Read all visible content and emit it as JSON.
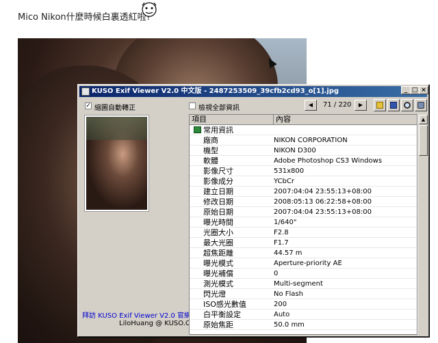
{
  "post": {
    "title": "Mico Nikon什麼時候白裏透紅啦?"
  },
  "window": {
    "title": "KUSO Exif Viewer V2.0 中文版 - 2487253509_39cfb2cd93_o[1].jpg",
    "controls": {
      "minimize": "_",
      "maximize": "□",
      "close": "×"
    }
  },
  "options": {
    "auto_rotate_label": "縮圖自動轉正",
    "auto_rotate_checked": "✓",
    "show_all_label": "檢視全部資訊"
  },
  "navigation": {
    "prev": "◀",
    "next": "▶",
    "counter": "71 / 220"
  },
  "grid": {
    "headers": {
      "item": "項目",
      "content": "內容"
    },
    "group": "常用資訊",
    "rows": [
      {
        "k": "廠商",
        "v": "NIKON CORPORATION"
      },
      {
        "k": "機型",
        "v": "NIKON D300"
      },
      {
        "k": "軟體",
        "v": "Adobe Photoshop CS3 Windows"
      },
      {
        "k": "影像尺寸",
        "v": "531x800"
      },
      {
        "k": "影像成分",
        "v": "YCbCr"
      },
      {
        "k": "建立日期",
        "v": "2007:04:04 23:55:13+08:00"
      },
      {
        "k": "修改日期",
        "v": "2008:05:13 06:22:58+08:00"
      },
      {
        "k": "原始日期",
        "v": "2007:04:04 23:55:13+08:00"
      },
      {
        "k": "曝光時間",
        "v": "1/640\""
      },
      {
        "k": "光圈大小",
        "v": "F2.8"
      },
      {
        "k": "最大光圈",
        "v": "F1.7"
      },
      {
        "k": "超焦距離",
        "v": "44.57 m"
      },
      {
        "k": "曝光模式",
        "v": "Aperture-priority AE"
      },
      {
        "k": "曝光補償",
        "v": "0"
      },
      {
        "k": "測光模式",
        "v": "Multi-segment"
      },
      {
        "k": "閃光燈",
        "v": "No Flash"
      },
      {
        "k": "ISO感光數值",
        "v": "200"
      },
      {
        "k": "白平衡設定",
        "v": "Auto"
      },
      {
        "k": "原始焦距",
        "v": "50.0 mm"
      }
    ]
  },
  "footer": {
    "link": "拜訪 KUSO Exif Viewer V2.0 官網",
    "credit": "LiloHuang @ KUSO.CC"
  },
  "colors": {
    "titlebar": "#0a246a",
    "window_bg": "#d4d0c8",
    "link": "#0000cc"
  }
}
